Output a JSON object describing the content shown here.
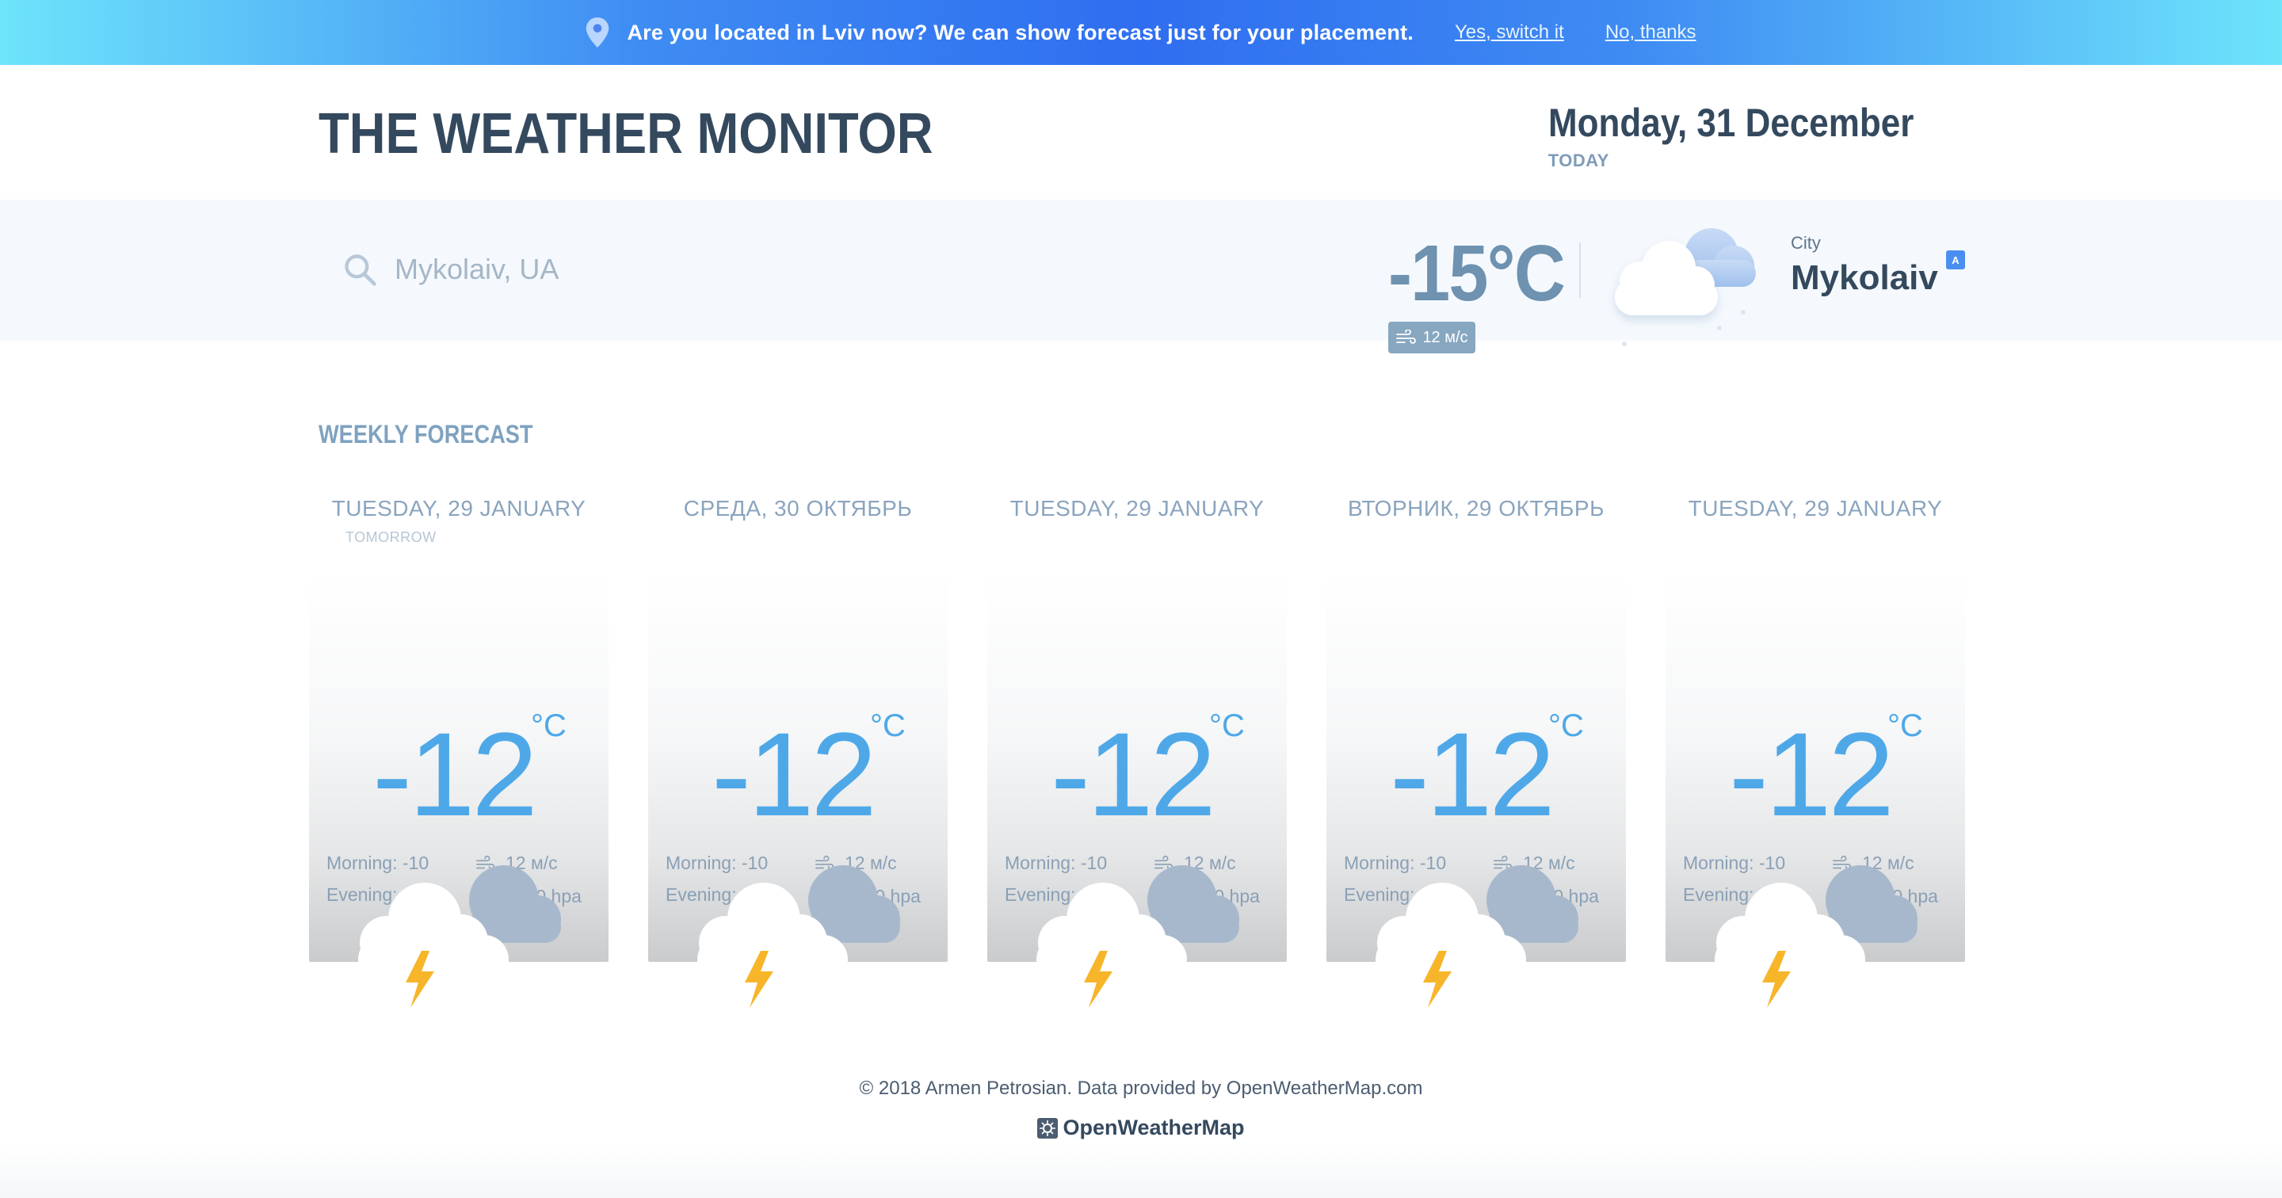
{
  "banner": {
    "message": "Are you located in Lviv now?  We can show forecast just for your placement.",
    "accept_label": "Yes, switch it",
    "decline_label": "No, thanks"
  },
  "header": {
    "title": "THE WEATHER MONITOR",
    "date": "Monday, 31 December",
    "date_sub": "TODAY"
  },
  "search": {
    "value": "Mykolaiv, UA"
  },
  "current": {
    "temperature": "-15°C",
    "wind": "12 м/с",
    "city_label": "City",
    "city": "Mykolaiv",
    "badge": "A"
  },
  "forecast": {
    "title": "WEEKLY FORECAST",
    "days": [
      {
        "day": "TUESDAY, 29 JANUARY",
        "sub": "TOMORROW",
        "temp": "-12",
        "unit": "°C",
        "morning": "Morning: -10",
        "evening": "Evening: -15",
        "wind": "12 м/с",
        "pressure": "1200 hpa"
      },
      {
        "day": "СРЕДА, 30 ОКТЯБРЬ",
        "sub": "",
        "temp": "-12",
        "unit": "°C",
        "morning": "Morning: -10",
        "evening": "Evening: -15",
        "wind": "12 м/с",
        "pressure": "1200 hpa"
      },
      {
        "day": "TUESDAY, 29 JANUARY",
        "sub": "",
        "temp": "-12",
        "unit": "°C",
        "morning": "Morning: -10",
        "evening": "Evening: -15",
        "wind": "12 м/с",
        "pressure": "1200 hpa"
      },
      {
        "day": "ВТОРНИК, 29 ОКТЯБРЬ",
        "sub": "",
        "temp": "-12",
        "unit": "°C",
        "morning": "Morning: -10",
        "evening": "Evening: -15",
        "wind": "12 м/с",
        "pressure": "1200 hpa"
      },
      {
        "day": "TUESDAY, 29 JANUARY",
        "sub": "",
        "temp": "-12",
        "unit": "°C",
        "morning": "Morning: -10",
        "evening": "Evening: -15",
        "wind": "12 м/с",
        "pressure": "1200 hpa"
      }
    ]
  },
  "footer": {
    "copyright": "© 2018 Armen Petrosian. Data provided by OpenWeatherMap.com",
    "brand": "OpenWeatherMap"
  },
  "colors": {
    "accent_blue": "#4ea8e8",
    "title_dark": "#34495e",
    "banner_blue": "#2f6ef0",
    "lightning": "#f7b52a"
  },
  "icons": [
    "location-pin-icon",
    "search-icon",
    "cloud-icon",
    "wind-icon",
    "pressure-icon",
    "thunderstorm-icon",
    "openweathermap-logo-icon"
  ]
}
